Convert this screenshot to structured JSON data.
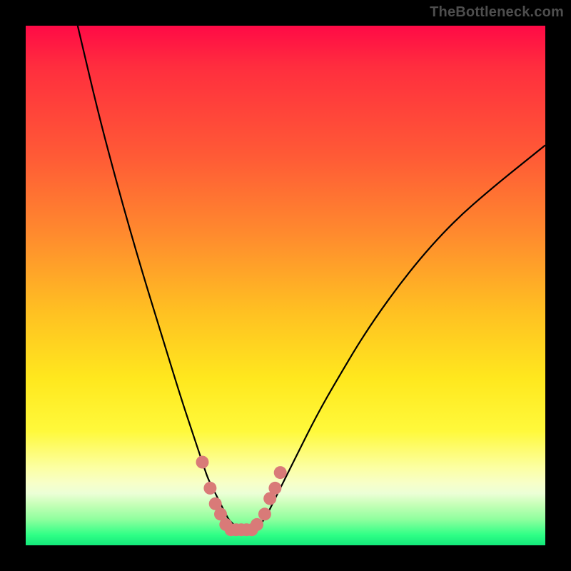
{
  "attribution": "TheBottleneck.com",
  "colors": {
    "frame": "#000000",
    "curve": "#000000",
    "marker": "#d97a78",
    "gradient_top": "#ff0a46",
    "gradient_bottom": "#13e87a"
  },
  "chart_data": {
    "type": "line",
    "title": "",
    "xlabel": "",
    "ylabel": "",
    "xlim": [
      0,
      100
    ],
    "ylim": [
      0,
      100
    ],
    "grid": false,
    "legend": false,
    "series": [
      {
        "name": "curve",
        "x": [
          10,
          14,
          18,
          22,
          26,
          30,
          32,
          34,
          35,
          36,
          37,
          38,
          39,
          40,
          41,
          42,
          43,
          44,
          45,
          46,
          48,
          52,
          56,
          60,
          66,
          74,
          82,
          90,
          100
        ],
        "y": [
          100,
          83,
          68,
          54,
          41,
          28,
          22,
          16,
          13,
          11,
          9,
          7,
          5,
          4,
          3,
          3,
          3,
          3,
          4,
          5,
          9,
          17,
          25,
          32,
          42,
          53,
          62,
          69,
          77
        ]
      }
    ],
    "markers": [
      {
        "x": 34.0,
        "y": 16
      },
      {
        "x": 35.5,
        "y": 11
      },
      {
        "x": 36.5,
        "y": 8
      },
      {
        "x": 37.5,
        "y": 6
      },
      {
        "x": 38.5,
        "y": 4
      },
      {
        "x": 39.5,
        "y": 3
      },
      {
        "x": 40.5,
        "y": 3
      },
      {
        "x": 41.5,
        "y": 3
      },
      {
        "x": 42.5,
        "y": 3
      },
      {
        "x": 43.5,
        "y": 3
      },
      {
        "x": 44.5,
        "y": 4
      },
      {
        "x": 46.0,
        "y": 6
      },
      {
        "x": 47.0,
        "y": 9
      },
      {
        "x": 48.0,
        "y": 11
      },
      {
        "x": 49.0,
        "y": 14
      }
    ]
  }
}
